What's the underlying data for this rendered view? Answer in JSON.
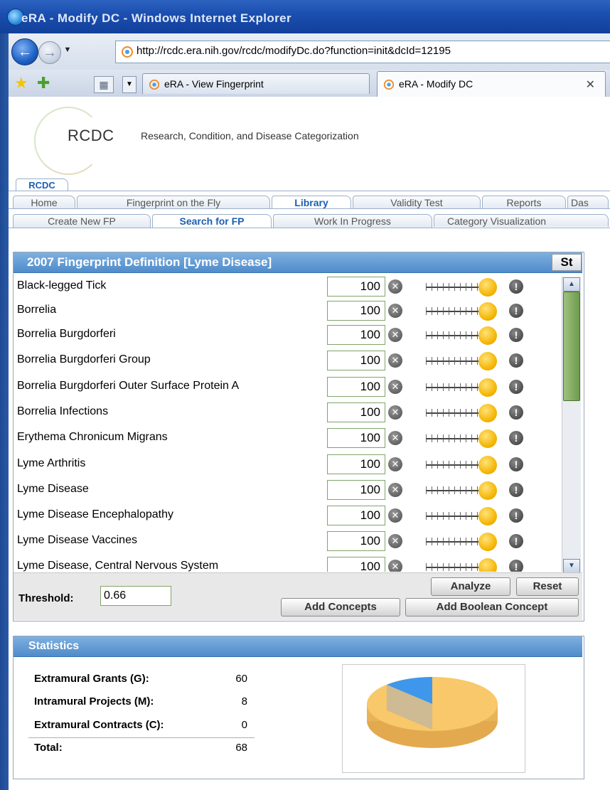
{
  "window": {
    "title": "eRA - Modify DC - Windows Internet Explorer"
  },
  "browser": {
    "url": "http://rcdc.era.nih.gov/rcdc/modifyDc.do?function=init&dcId=12195",
    "tabs": [
      {
        "label": "eRA - View Fingerprint",
        "active": false
      },
      {
        "label": "eRA - Modify DC",
        "active": true
      }
    ]
  },
  "app": {
    "logo": "RCDC",
    "subtitle": "Research, Condition, and Disease Categorization",
    "top_tab": "RCDC",
    "main_tabs": [
      "Home",
      "Fingerprint on the Fly",
      "Library",
      "Validity Test",
      "Reports",
      "Das"
    ],
    "main_tab_active": "Library",
    "sub_tabs": [
      "Create New FP",
      "Search for FP",
      "Work In Progress",
      "Category Visualization"
    ],
    "sub_tab_active": "Search for FP"
  },
  "fingerprint": {
    "title": "2007 Fingerprint Definition [Lyme Disease]",
    "st_button": "St",
    "rows": [
      {
        "label": "Black-legged Tick",
        "value": "100"
      },
      {
        "label": "Borrelia",
        "value": "100"
      },
      {
        "label": "Borrelia Burgdorferi",
        "value": "100"
      },
      {
        "label": "Borrelia Burgdorferi Group",
        "value": "100"
      },
      {
        "label": "Borrelia Burgdorferi Outer Surface Protein A",
        "value": "100"
      },
      {
        "label": "Borrelia Infections",
        "value": "100"
      },
      {
        "label": "Erythema Chronicum Migrans",
        "value": "100"
      },
      {
        "label": "Lyme Arthritis",
        "value": "100"
      },
      {
        "label": "Lyme Disease",
        "value": "100"
      },
      {
        "label": "Lyme Disease Encephalopathy",
        "value": "100"
      },
      {
        "label": "Lyme Disease Vaccines",
        "value": "100"
      },
      {
        "label": "Lyme Disease, Central Nervous System",
        "value": "100"
      }
    ],
    "threshold_label": "Threshold:",
    "threshold_value": "0.66",
    "buttons": {
      "analyze": "Analyze",
      "reset": "Reset",
      "add_concepts": "Add Concepts",
      "add_boolean": "Add Boolean Concept"
    }
  },
  "statistics": {
    "title": "Statistics",
    "items": [
      {
        "label": "Extramural Grants (G):",
        "value": "60"
      },
      {
        "label": "Intramural Projects (M):",
        "value": "8"
      },
      {
        "label": "Extramural Contracts (C):",
        "value": "0"
      }
    ],
    "total_label": "Total:",
    "total_value": "68"
  },
  "colors": {
    "accent_blue": "#4f8cca",
    "pie_main": "#f8c86a",
    "pie_slice": "#3f97ec"
  }
}
